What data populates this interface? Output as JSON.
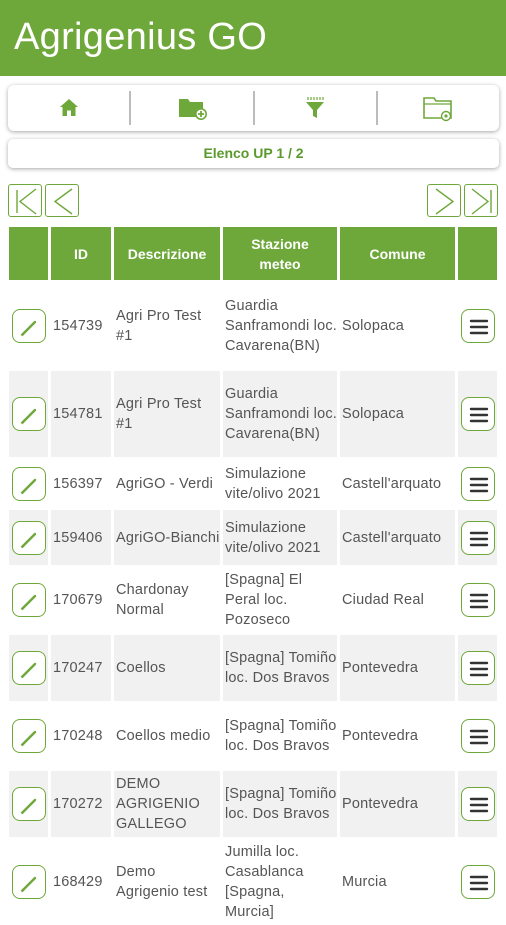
{
  "app": {
    "title": "Agrigenius GO"
  },
  "toolbar": {
    "items": [
      {
        "icon": "home-icon"
      },
      {
        "icon": "folder-add-icon"
      },
      {
        "icon": "filter-icon"
      },
      {
        "icon": "folder-settings-icon"
      }
    ]
  },
  "pager": {
    "label": "Elenco UP 1 / 2"
  },
  "colors": {
    "primary": "#6fa83a",
    "row_alt": "#f1f1f1"
  },
  "table": {
    "headers": {
      "id": "ID",
      "desc": "Descrizione",
      "station": "Stazione meteo",
      "comune": "Comune"
    },
    "rows": [
      {
        "id": "154739",
        "desc": "Agri Pro Test #1",
        "station": "Guardia Sanframondi loc. Cavarena(BN)",
        "comune": "Solopaca"
      },
      {
        "id": "154781",
        "desc": "Agri Pro Test #1",
        "station": "Guardia Sanframondi loc. Cavarena(BN)",
        "comune": "Solopaca"
      },
      {
        "id": "156397",
        "desc": "AgriGO - Verdi",
        "station": "Simulazione vite/olivo 2021",
        "comune": "Castell'arquato"
      },
      {
        "id": "159406",
        "desc": "AgriGO-Bianchi",
        "station": "Simulazione vite/olivo 2021",
        "comune": "Castell'arquato"
      },
      {
        "id": "170679",
        "desc": "Chardonay Normal",
        "station": "[Spagna] El Peral loc. Pozoseco",
        "comune": "Ciudad Real"
      },
      {
        "id": "170247",
        "desc": "Coellos",
        "station": "[Spagna] Tomiño loc. Dos Bravos",
        "comune": "Pontevedra"
      },
      {
        "id": "170248",
        "desc": "Coellos medio",
        "station": "[Spagna] Tomiño loc. Dos Bravos",
        "comune": "Pontevedra"
      },
      {
        "id": "170272",
        "desc": "DEMO AGRIGENIO GALLEGO",
        "station": "[Spagna] Tomiño loc. Dos Bravos",
        "comune": "Pontevedra"
      },
      {
        "id": "168429",
        "desc": "Demo Agrigenio test",
        "station": "Jumilla loc. Casablanca [Spagna, Murcia]",
        "comune": "Murcia"
      }
    ]
  }
}
